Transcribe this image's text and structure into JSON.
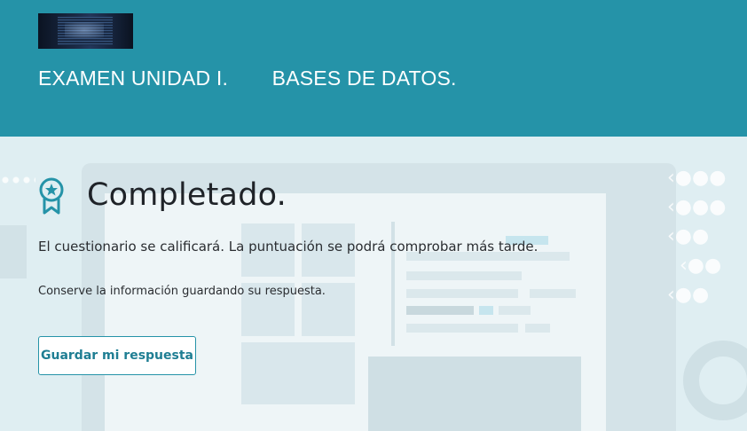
{
  "header": {
    "image_alt": "laptop-code-image",
    "title_part1": "EXAMEN UNIDAD I.",
    "title_part2": "BASES DE DATOS."
  },
  "completion": {
    "heading": "Completado.",
    "message": "El cuestionario se calificará. La puntuación se podrá comprobar más tarde.",
    "note": "Conserve la información guardando su respuesta.",
    "save_button_label": "Guardar mi respuesta"
  },
  "colors": {
    "header_bg": "#2593a8",
    "content_bg": "#dfeef2",
    "accent": "#2593a8"
  },
  "icons": {
    "award": "award-ribbon-icon"
  }
}
